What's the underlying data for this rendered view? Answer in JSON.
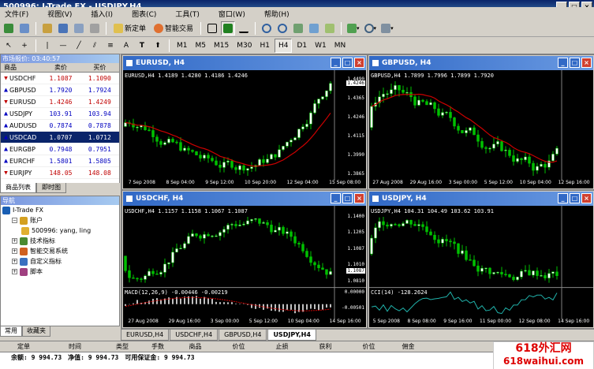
{
  "window": {
    "title": "500996: I-Trade FX - USDJPY,H4"
  },
  "menu": [
    "文件(F)",
    "视图(V)",
    "插入(I)",
    "图表(C)",
    "工具(T)",
    "窗口(W)",
    "帮助(H)"
  ],
  "toolbar": {
    "new_order": "新定单",
    "expert": "智能交易",
    "timeframes": [
      "M1",
      "M5",
      "M15",
      "M30",
      "H1",
      "H4",
      "D1",
      "W1",
      "MN"
    ],
    "active_timeframe": "H4"
  },
  "market_watch": {
    "title": "市场报价: 03:40:57",
    "columns": [
      "商品",
      "卖价",
      "买价"
    ],
    "rows": [
      {
        "symbol": "USDCHF",
        "bid": "1.1087",
        "ask": "1.1090",
        "dir": "dn"
      },
      {
        "symbol": "GBPUSD",
        "bid": "1.7920",
        "ask": "1.7924",
        "dir": "up"
      },
      {
        "symbol": "EURUSD",
        "bid": "1.4246",
        "ask": "1.4249",
        "dir": "dn"
      },
      {
        "symbol": "USDJPY",
        "bid": "103.91",
        "ask": "103.94",
        "dir": "up"
      },
      {
        "symbol": "AUDUSD",
        "bid": "0.7874",
        "ask": "0.7878",
        "dir": "up"
      },
      {
        "symbol": "USDCAD",
        "bid": "1.0707",
        "ask": "1.0712",
        "dir": "up",
        "selected": true
      },
      {
        "symbol": "EURGBP",
        "bid": "0.7948",
        "ask": "0.7951",
        "dir": "up"
      },
      {
        "symbol": "EURCHF",
        "bid": "1.5801",
        "ask": "1.5805",
        "dir": "up"
      },
      {
        "symbol": "EURJPY",
        "bid": "148.05",
        "ask": "148.08",
        "dir": "dn"
      }
    ],
    "tabs": [
      "商品列表",
      "即时图"
    ]
  },
  "navigator": {
    "title": "导航",
    "items": [
      {
        "label": "I-Trade FX",
        "level": 0
      },
      {
        "label": "账户",
        "level": 1
      },
      {
        "label": "500996: yang, ling",
        "level": 2
      },
      {
        "label": "技术指标",
        "level": 1
      },
      {
        "label": "智能交易系统",
        "level": 1
      },
      {
        "label": "自定义指标",
        "level": 1
      },
      {
        "label": "脚本",
        "level": 1
      }
    ],
    "tabs": [
      "常用",
      "收藏夹"
    ]
  },
  "charts": [
    {
      "title": "EURUSD, H4",
      "info": "EURUSD,H4  1.4189 1.4280 1.4186 1.4246",
      "yticks": [
        "1.4490",
        "1.4365",
        "1.4246",
        "1.4115",
        "1.3990",
        "1.3865"
      ],
      "xticks": [
        "7 Sep 2008",
        "8 Sep 04:00",
        "9 Sep 12:00",
        "10 Sep 20:00",
        "12 Sep 04:00",
        "15 Sep 08:00"
      ],
      "price_tag": "1.4246"
    },
    {
      "title": "GBPUSD, H4",
      "info": "GBPUSD,H4  1.7899 1.7996 1.7899 1.7920",
      "yticks": [],
      "xticks": [
        "27 Aug 2008",
        "29 Aug 16:00",
        "3 Sep 00:00",
        "5 Sep 12:00",
        "10 Sep 04:00",
        "12 Sep 16:00"
      ],
      "price_tag": ""
    },
    {
      "title": "USDCHF, H4",
      "info": "USDCHF,H4  1.1157 1.1158 1.1067 1.1087",
      "yticks": [
        "1.1400",
        "1.1205",
        "1.1087",
        "1.1010",
        "1.0810",
        "0.00000",
        "-0.00501"
      ],
      "xticks": [
        "27 Aug 2008",
        "29 Aug 16:00",
        "3 Sep 00:00",
        "5 Sep 12:00",
        "10 Sep 04:00",
        "14 Sep 16:00"
      ],
      "price_tag": "1.1087",
      "indicator": "MACD(12,26,9) -0.00446 -0.00219"
    },
    {
      "title": "USDJPY, H4",
      "info": "USDJPY,H4  104.31 104.49 103.62 103.91",
      "yticks": [],
      "xticks": [
        "5 Sep 2008",
        "8 Sep 08:00",
        "9 Sep 16:00",
        "11 Sep 00:00",
        "12 Sep 08:00",
        "14 Sep 16:00"
      ],
      "price_tag": "",
      "indicator": "CCI(14) -128.2624"
    }
  ],
  "chart_tabs": [
    "EURUSD,H4",
    "USDCHF,H4",
    "GBPUSD,H4",
    "USDJPY,H4"
  ],
  "active_chart_tab": "USDJPY,H4",
  "terminal": {
    "columns": [
      "定单",
      "时间",
      "类型",
      "手数",
      "商品",
      "价位",
      "止损",
      "获利",
      "价位",
      "佣金",
      "库存费",
      "获利"
    ],
    "summary_parts": [
      "余额: 9 994.73",
      "净值: 9 994.73",
      "可用保证金: 9 994.73"
    ]
  },
  "watermark": {
    "line1": "618外汇网",
    "line2": "618waihui.com"
  },
  "colors": {
    "bull_candle": "#ffffff",
    "bear_candle": "#00c000",
    "moving_average": "#cc0000",
    "chart_bg": "#000000"
  }
}
